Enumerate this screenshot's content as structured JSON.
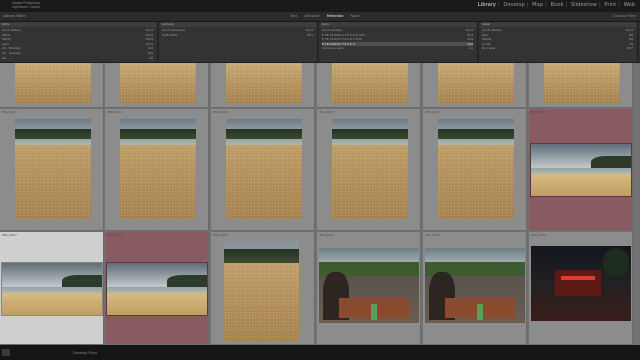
{
  "app": {
    "name_line1": "Adobe Photoshop",
    "name_line2": "Lightroom Classic"
  },
  "modules": [
    "Library",
    "Develop",
    "Map",
    "Book",
    "Slideshow",
    "Print",
    "Web"
  ],
  "filter_bar": {
    "label": "Library Filter:",
    "tabs": [
      "Text",
      "Attribute",
      "Metadata",
      "None"
    ],
    "active_tab": "Metadata",
    "right_label": "Custom Filter"
  },
  "browser_columns": [
    {
      "header": "Date",
      "rows": [
        {
          "label": "All (3 Dates)",
          "count": "1013"
        },
        {
          "label": "2019",
          "count": "1013"
        },
        {
          "label": "March",
          "count": "1013"
        },
        {
          "label": "April",
          "count": "1013"
        },
        {
          "label": "24 - Monday",
          "count": "112"
        },
        {
          "label": "25 - Tuesday",
          "count": "184"
        },
        {
          "label": "26 - ...",
          "count": "98"
        }
      ]
    },
    {
      "header": "Camera",
      "rows": [
        {
          "label": "All (2 Cameras)",
          "count": "1013"
        },
        {
          "label": "ILCE-6000",
          "count": "851"
        }
      ]
    },
    {
      "header": "Lens",
      "rows": [
        {
          "label": "All (4 Lenses)",
          "count": "1013"
        },
        {
          "label": "E PZ 16-50mm F3.5-5.6 OSS",
          "count": "613"
        },
        {
          "label": "E 55-210mm F4.5-6.3 OSS",
          "count": "214"
        },
        {
          "label": "E 18-200mm F3.5-6.3",
          "count": "122"
        },
        {
          "label": "Unknown Lens",
          "count": "64"
        }
      ]
    },
    {
      "header": "Label",
      "rows": [
        {
          "label": "All (6 Labels)",
          "count": "1013"
        },
        {
          "label": "Red",
          "count": "80"
        },
        {
          "label": "Yellow",
          "count": "62"
        },
        {
          "label": "Green",
          "count": "44"
        },
        {
          "label": "No Label",
          "count": "827"
        }
      ]
    }
  ],
  "grid": {
    "row1": [
      "",
      "",
      "",
      "",
      "",
      ""
    ],
    "row2": [
      "IMG_0621",
      "IMG_0622",
      "IMG_0623",
      "IMG_0624",
      "IMG_0625",
      "IMG_0626"
    ],
    "row3": [
      "IMG_0627",
      "IMG_0628",
      "IMG_0629",
      "IMG_0630",
      "IMG_0631",
      "IMG_0632"
    ]
  },
  "bottom_bar": {
    "label": "Develop Filter"
  },
  "colors": {
    "selected": "#cfcfcf",
    "red_label": "#8a5a62",
    "cell": "#8c8c8c"
  }
}
